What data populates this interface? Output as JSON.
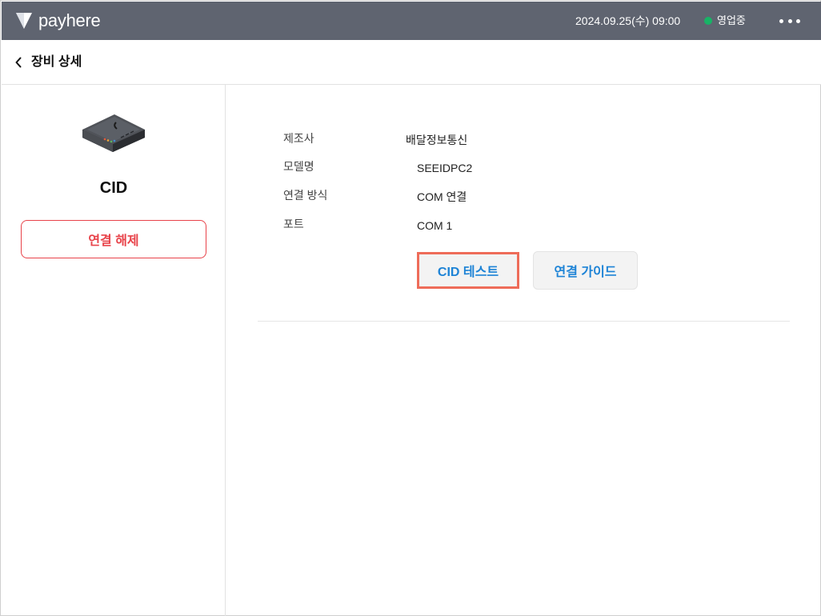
{
  "app": {
    "logo_text": "payhere"
  },
  "topbar": {
    "datetime": "2024.09.25(수) 09:00",
    "status_label": "영업중",
    "status_color": "#18b366",
    "background_color": "#5f6470",
    "more_icon": "more-horizontal-icon"
  },
  "header": {
    "title": "장비 상세",
    "back_icon": "chevron-left-icon"
  },
  "device": {
    "name": "CID",
    "image_icon": "cid-device-icon",
    "disconnect_label": "연결 해제",
    "disconnect_color": "#e8434a"
  },
  "details": {
    "rows": [
      {
        "label": "제조사",
        "value": "배달정보통신"
      },
      {
        "label": "모델명",
        "value": "SEEIDPC2"
      },
      {
        "label": "연결 방식",
        "value": "COM 연결"
      },
      {
        "label": "포트",
        "value": "COM 1"
      }
    ]
  },
  "actions": {
    "cid_test_label": "CID 테스트",
    "guide_label": "연결 가이드",
    "accent_color": "#1d83d6",
    "highlight_color": "#ee6c59"
  }
}
